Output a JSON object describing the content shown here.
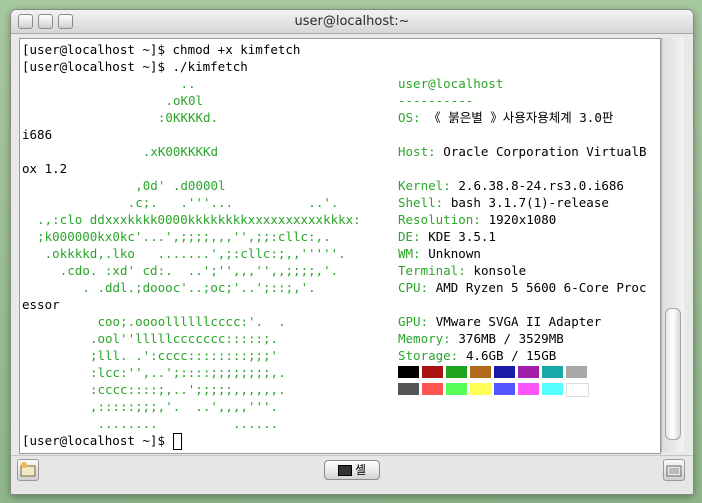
{
  "window": {
    "title": "user@localhost:~"
  },
  "terminal": {
    "lines": [
      {
        "text": "[user@localhost ~]$ chmod +x kimfetch",
        "color": "black",
        "col": 0
      },
      {
        "text": "[user@localhost ~]$ ./kimfetch",
        "color": "black",
        "col": 0
      },
      {
        "text": "..",
        "color": "green",
        "col": 21
      },
      {
        "text": ".oK0l",
        "color": "green",
        "col": 19
      },
      {
        "text": ":0KKKKd.",
        "color": "green",
        "col": 18
      },
      {
        "text": "i686",
        "color": "black",
        "col": 0
      },
      {
        "text": ".xK00KKKKd",
        "color": "green",
        "col": 16
      },
      {
        "text": "ox 1.2",
        "color": "black",
        "col": 0
      },
      {
        "text": ",0d' .d0000l",
        "color": "green",
        "col": 15
      },
      {
        "text": ".c;.   .'''...          ..'.",
        "color": "green",
        "col": 14
      },
      {
        "text": ".,:clo ddxxxkkkk0000kkkkkkkkxxxxxxxxxxkkkx:",
        "color": "green",
        "col": 2
      },
      {
        "text": ";k000000kx0kc'...',;;;;,,,'',;;:cllc:,.",
        "color": "green",
        "col": 2
      },
      {
        "text": ".okkkkd,.lko   .......',;:cllc:;,,'''''.",
        "color": "green",
        "col": 3
      },
      {
        "text": ".cdo. :xd' cd:.  ..';'',,,'',,;;;;,'.",
        "color": "green",
        "col": 5
      },
      {
        "text": ". .ddl.;doooc'..;oc;'..';::;,'.",
        "color": "green",
        "col": 8
      },
      {
        "text": "essor",
        "color": "black",
        "col": 0
      },
      {
        "text": "coo;.oooollllllcccc:'.  .",
        "color": "green",
        "col": 10
      },
      {
        "text": ".ool''lllllccccccc:::::;.",
        "color": "green",
        "col": 9
      },
      {
        "text": ";lll. .':cccc::::::::;;;'",
        "color": "green",
        "col": 9
      },
      {
        "text": ":lcc:'',..';::::;;;;;;;;,.",
        "color": "green",
        "col": 9
      },
      {
        "text": ":cccc::::;,..';;;;;,,,,,,.",
        "color": "green",
        "col": 9
      },
      {
        "text": ",:::::;;;,'.  ..',,,,'''.",
        "color": "green",
        "col": 9
      },
      {
        "text": "........          ......",
        "color": "green",
        "col": 10
      },
      {
        "text": "[user@localhost ~]$ ",
        "color": "black",
        "col": 0
      }
    ],
    "info": [
      {
        "label": "user@localhost",
        "value": ""
      },
      {
        "label": "----------",
        "value": ""
      },
      {
        "label": "OS:",
        "value": "《 붉은별 》사용자용체계 3.0판"
      },
      {
        "label": "",
        "value": ""
      },
      {
        "label": "Host:",
        "value": "Oracle Corporation VirtualB"
      },
      {
        "label": "",
        "value": ""
      },
      {
        "label": "Kernel:",
        "value": "2.6.38.8-24.rs3.0.i686"
      },
      {
        "label": "Shell:",
        "value": "bash 3.1.7(1)-release"
      },
      {
        "label": "Resolution:",
        "value": "1920x1080"
      },
      {
        "label": "DE:",
        "value": "KDE 3.5.1"
      },
      {
        "label": "WM:",
        "value": "Unknown"
      },
      {
        "label": "Terminal:",
        "value": "konsole"
      },
      {
        "label": "CPU:",
        "value": "AMD Ryzen 5 5600 6-Core Proc"
      },
      {
        "label": "",
        "value": ""
      },
      {
        "label": "GPU:",
        "value": "VMware SVGA II Adapter"
      },
      {
        "label": "Memory:",
        "value": "376MB / 3529MB"
      },
      {
        "label": "Storage:",
        "value": "4.6GB / 15GB"
      }
    ],
    "palette_row1": [
      "#000000",
      "#aa1111",
      "#1fa41f",
      "#b06a1a",
      "#1a1aa8",
      "#a11ea8",
      "#19a8a8",
      "#a8a8a8"
    ],
    "palette_row2": [
      "#555555",
      "#ff5555",
      "#55ff55",
      "#ffff55",
      "#5555ff",
      "#ff55ff",
      "#55ffff",
      "#ffffff"
    ]
  },
  "statusbar": {
    "tab_label": "셸",
    "tab_icon": "terminal-icon"
  }
}
